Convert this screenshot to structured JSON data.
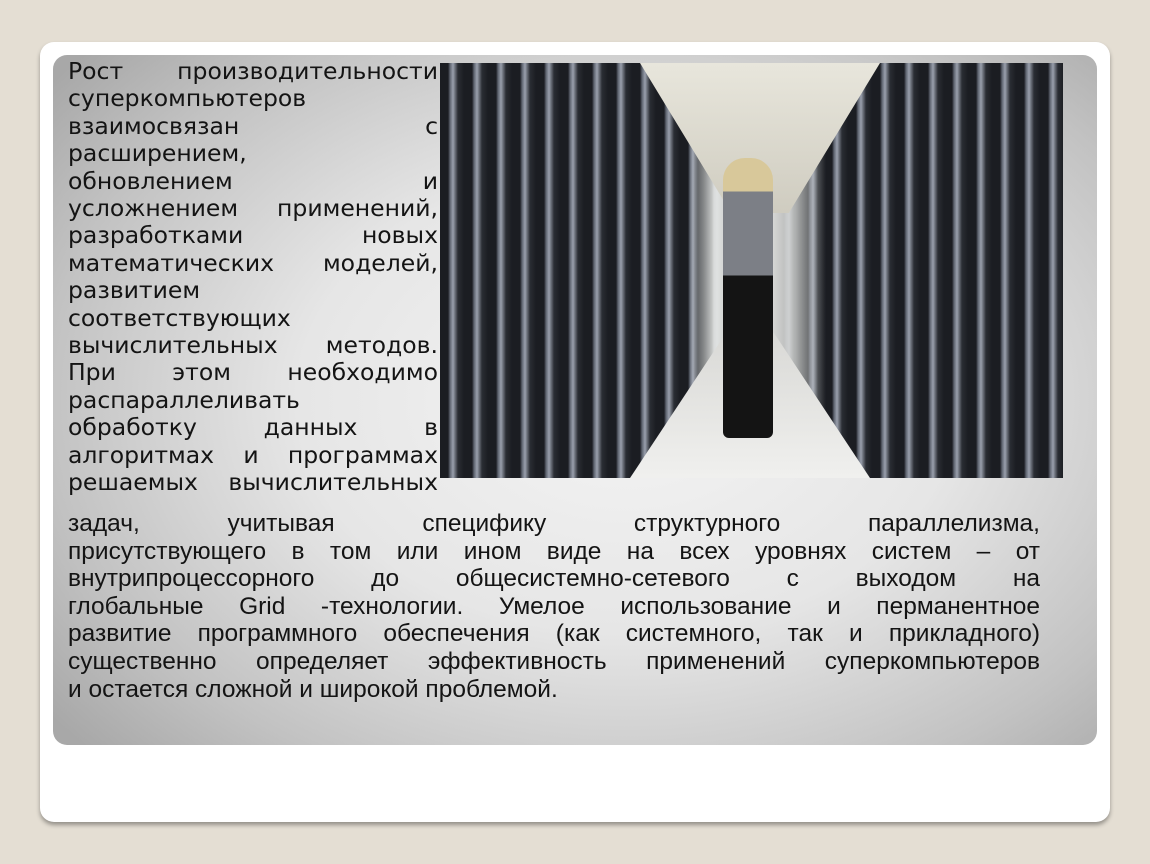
{
  "slide": {
    "left_column_lines": [
      "Рост производительности",
      "суперкомпьютеров",
      "взаимосвязан с",
      "расширением,",
      "обновлением и",
      "усложнением применений,",
      "разработками новых",
      "математических моделей,",
      "развитием",
      "соответствующих",
      "вычислительных методов.",
      "При этом необходимо",
      "распараллеливать",
      "обработку данных в",
      "алгоритмах и программах",
      "решаемых вычислительных"
    ],
    "bottom_lines": [
      "задач, учитывая специфику структурного параллелизма,",
      "присутствующего в том или ином виде на всех уровнях систем – от",
      "внутрипроцессорного до общесистемно-сетевого с выходом на",
      "глобальные Grid -технологии. Умелое использование и перманентное",
      "развитие программного обеспечения (как системного, так и прикладного)",
      "существенно определяет эффективность применений суперкомпьютеров",
      "и остается сложной и широкой проблемой."
    ],
    "photo": "supercomputer-server-room-photo",
    "colors": {
      "background": "#e4ded3",
      "card": "#ffffff",
      "text": "#141414"
    }
  }
}
